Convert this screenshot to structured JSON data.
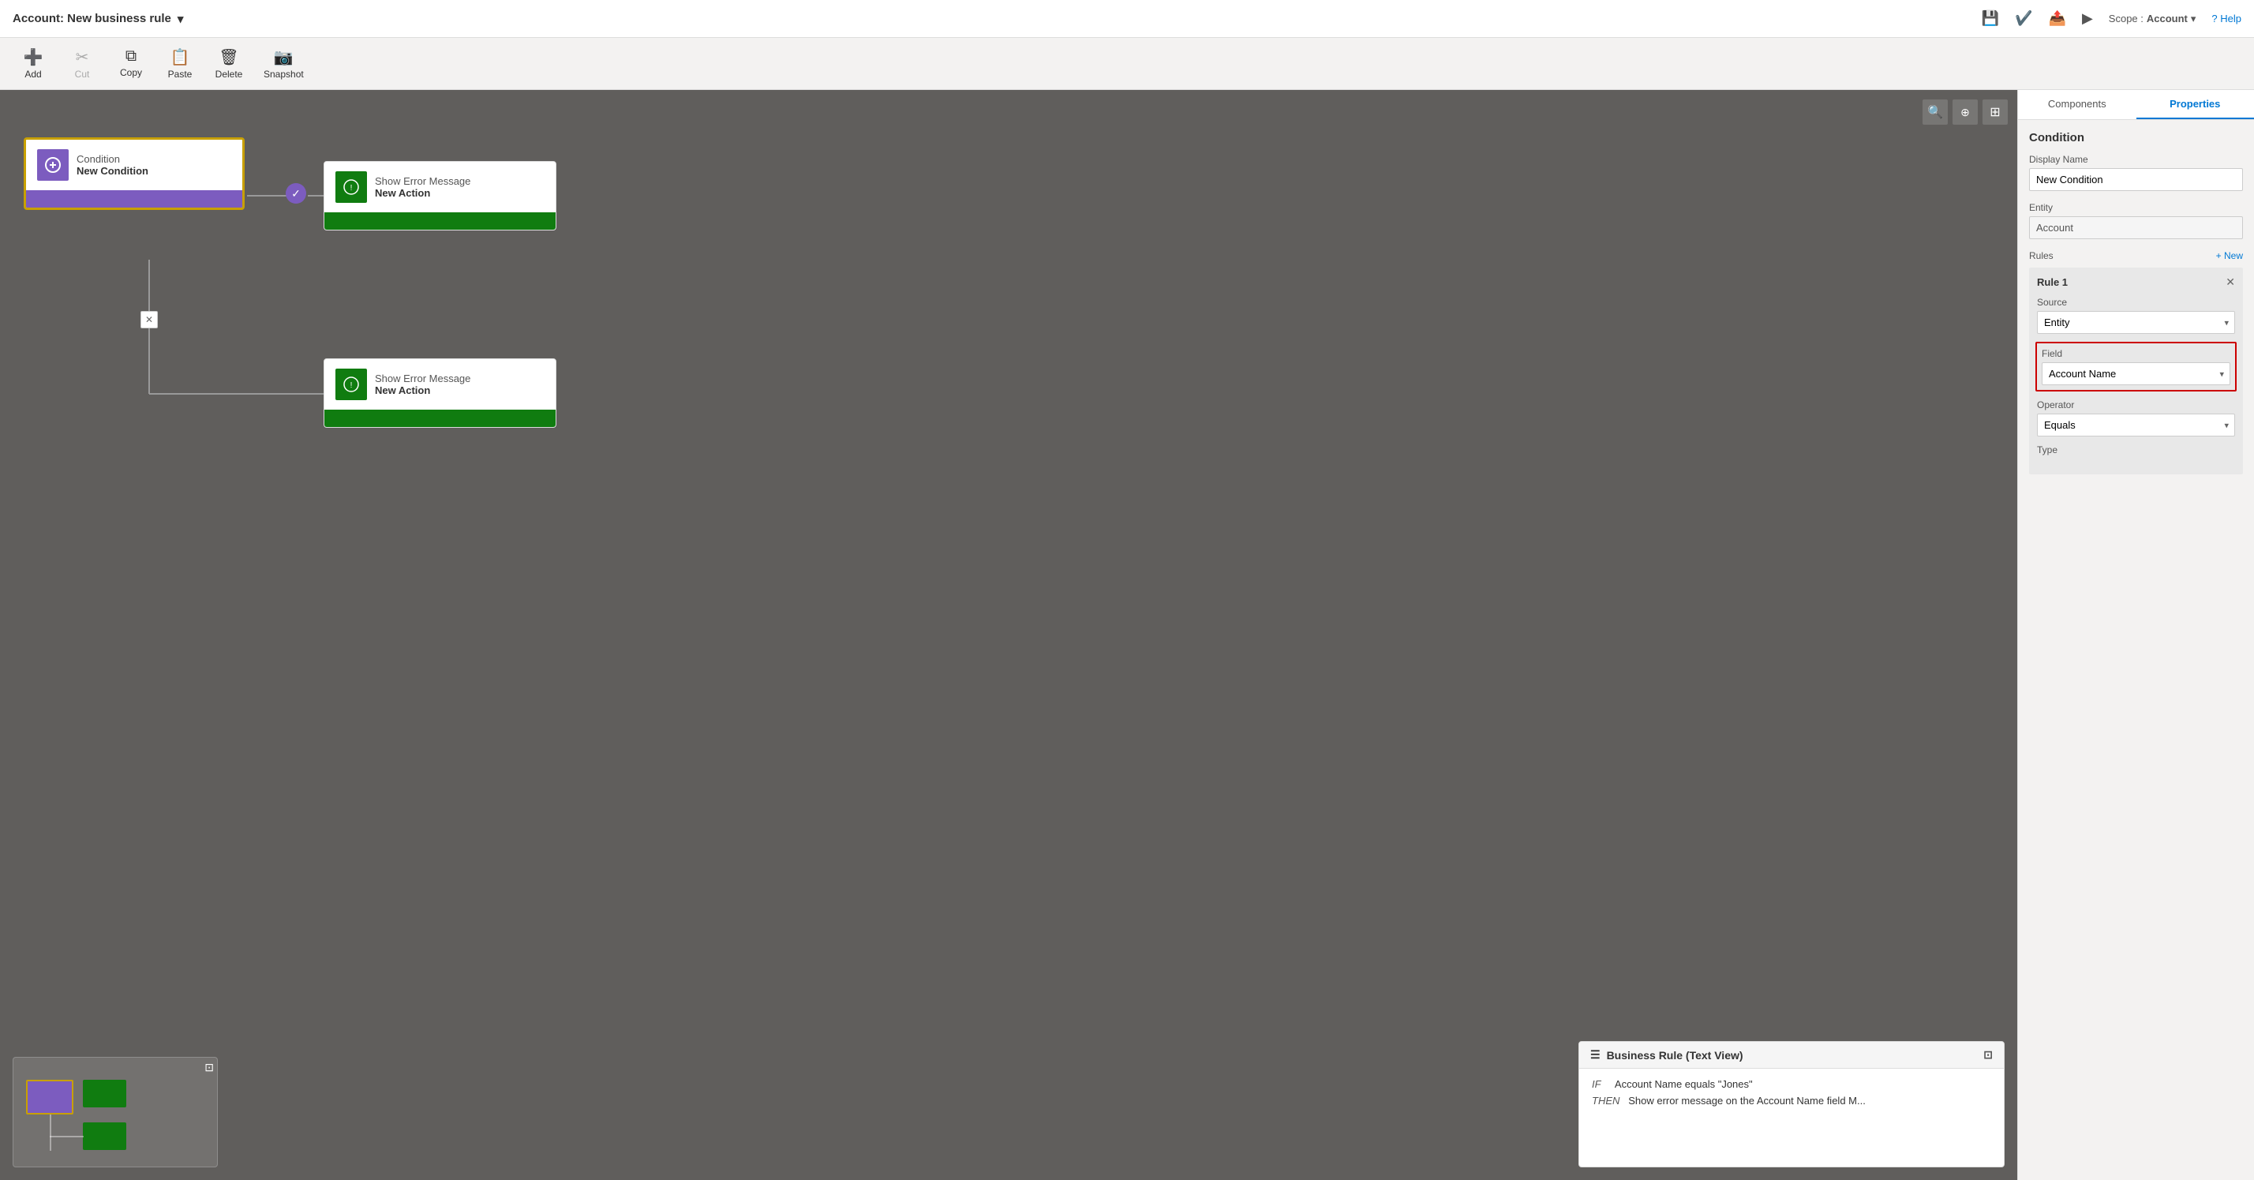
{
  "titleBar": {
    "title": "Account: New business rule",
    "chevron": "▾",
    "icons": [
      "save",
      "check",
      "publish",
      "play",
      "scope"
    ],
    "scopeLabel": "Scope :",
    "scopeValue": "Account",
    "helpLabel": "? Help"
  },
  "toolbar": {
    "buttons": [
      {
        "id": "add",
        "icon": "+",
        "label": "Add",
        "disabled": false
      },
      {
        "id": "cut",
        "icon": "✂",
        "label": "Cut",
        "disabled": true
      },
      {
        "id": "copy",
        "icon": "⧉",
        "label": "Copy",
        "disabled": false
      },
      {
        "id": "paste",
        "icon": "📋",
        "label": "Paste",
        "disabled": false
      },
      {
        "id": "delete",
        "icon": "🗑",
        "label": "Delete",
        "disabled": false
      },
      {
        "id": "snapshot",
        "icon": "📷",
        "label": "Snapshot",
        "disabled": false
      }
    ]
  },
  "canvas": {
    "zoomOut": "−",
    "zoomIn": "+",
    "expand": "⊡"
  },
  "conditionNode": {
    "type": "Condition",
    "name": "New Condition"
  },
  "actionNodeTop": {
    "type": "Show Error Message",
    "name": "New Action"
  },
  "actionNodeBottom": {
    "type": "Show Error Message",
    "name": "New Action"
  },
  "textView": {
    "title": "Business Rule (Text View)",
    "if": "IF",
    "then": "THEN",
    "ifBody": "Account Name equals \"Jones\"",
    "thenBody": "Show error message on the Account Name field M..."
  },
  "rightPanel": {
    "tabs": [
      "Components",
      "Properties"
    ],
    "activeTab": "Properties",
    "sectionTitle": "Condition",
    "displayNameLabel": "Display Name",
    "displayNameValue": "New Condition",
    "entityLabel": "Entity",
    "entityValue": "Account",
    "rulesLabel": "Rules",
    "newLabel": "+ New",
    "rule": {
      "title": "Rule 1",
      "sourceLabel": "Source",
      "sourceValue": "Entity",
      "fieldLabel": "Field",
      "fieldValue": "Account Name",
      "operatorLabel": "Operator",
      "operatorValue": "Equals",
      "typeLabel": "Type"
    }
  }
}
